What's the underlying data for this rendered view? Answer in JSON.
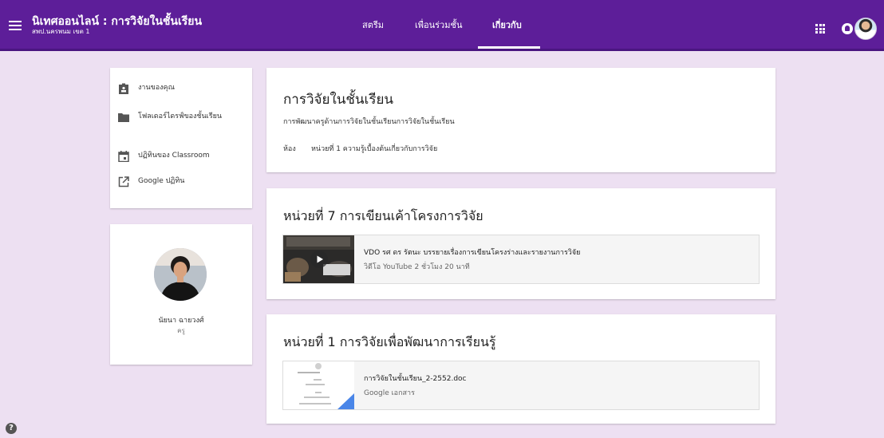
{
  "header": {
    "class_title": "นิเทศออนไลน์ : การวิจัยในชั้นเรียน",
    "class_subtitle": "สพป.นครพนม เขต 1",
    "tabs": [
      {
        "label": "สตรีม",
        "active": false
      },
      {
        "label": "เพื่อนร่วมชั้น",
        "active": false
      },
      {
        "label": "เกี่ยวกับ",
        "active": true
      }
    ],
    "icons": [
      "menu-icon",
      "apps-icon",
      "notifications-icon",
      "profile-avatar"
    ],
    "color": "#5d1e99"
  },
  "sidebar": {
    "items": [
      {
        "label": "งานของคุณ",
        "icon": "assignment-icon"
      },
      {
        "label": "โฟลเดอร์ไดรฟ์ของชั้นเรียน",
        "icon": "folder-icon"
      },
      {
        "label": "ปฏิทินของ Classroom",
        "icon": "calendar-icon"
      },
      {
        "label": "Google ปฏิทิน",
        "icon": "external-link-icon"
      }
    ]
  },
  "teacher": {
    "name": "นัยนา ฉายวงศ์",
    "role": "ครู"
  },
  "about": {
    "title": "การวิจัยในชั้นเรียน",
    "description": "การพัฒนาครูด้านการวิจัยในชั้นเรียนการวิจัยในชั้นเรียน",
    "room_label": "ห้อง",
    "room_value": "หน่วยที่ 1 ความรู้เบื้องต้นเกี่ยวกับการวิจัย"
  },
  "topics": [
    {
      "title": "หน่วยที่ 7 การเขียนเค้าโครงการวิจัย",
      "attachment": {
        "title": "VDO รศ ดร รัตนะ บรรยายเรื่องการเขียนโครงร่างและรายงานการวิจัย",
        "subtitle": "วิดีโอ YouTube  2 ชั่วโมง 20 นาที",
        "kind": "video"
      }
    },
    {
      "title": "หน่วยที่ 1 การวิจัยเพื่อพัฒนาการเรียนรู้",
      "attachment": {
        "title": "การวิจัยในชั้นเรียน_2-2552.doc",
        "subtitle": "Google เอกสาร",
        "kind": "document"
      }
    }
  ],
  "help": {
    "label": "?"
  }
}
